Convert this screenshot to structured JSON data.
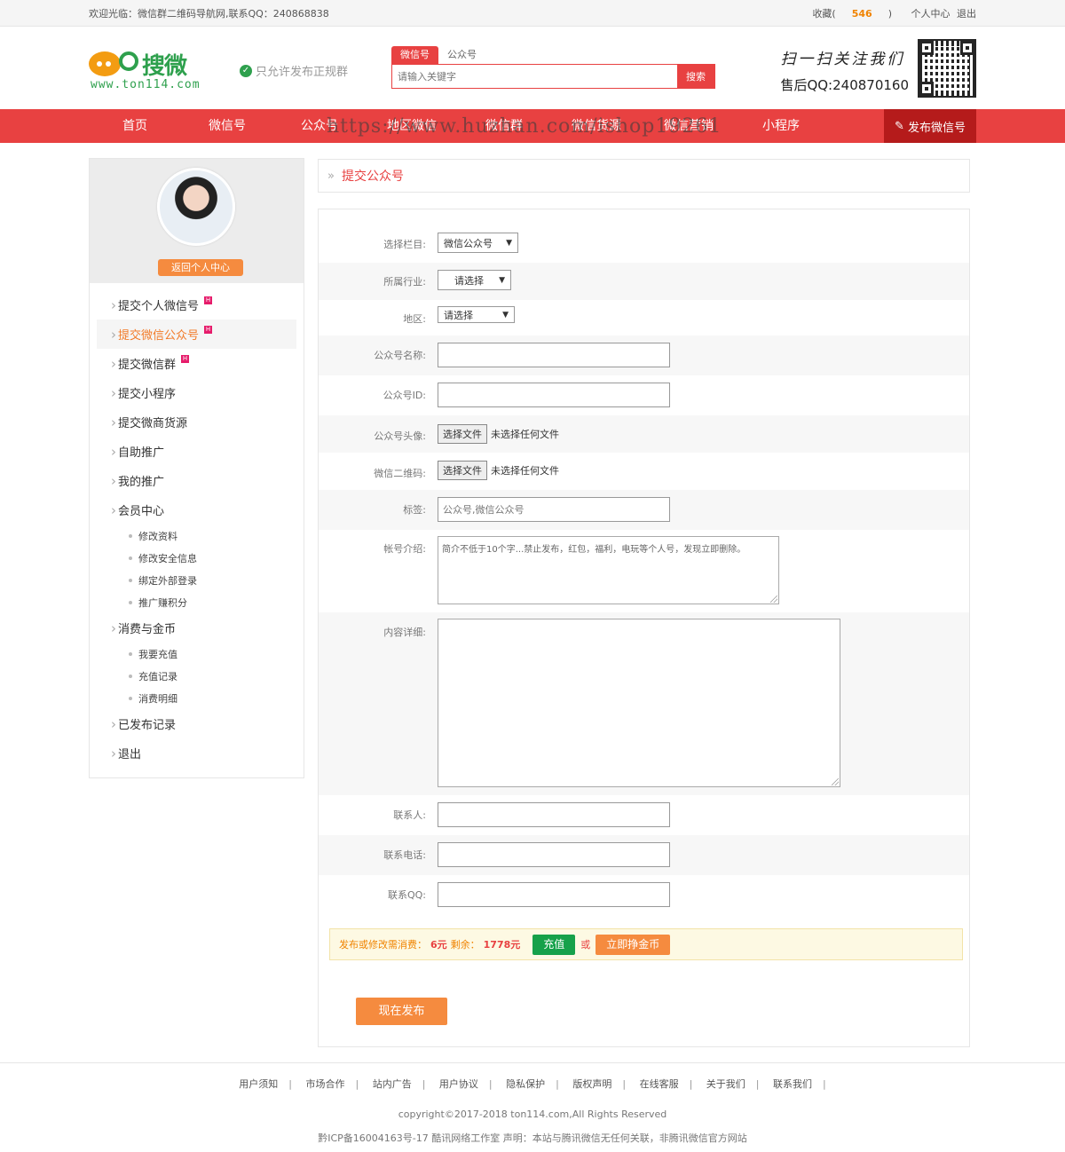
{
  "topbar": {
    "welcome": "欢迎光临：微信群二维码导航网,联系QQ：240868838",
    "fav_label": "收藏(",
    "fav_count": "546",
    "fav_close": ")",
    "user_center": "个人中心",
    "logout": "退出"
  },
  "header": {
    "brand": "搜微",
    "url": "www.ton114.com",
    "verified": "只允许发布正规群",
    "slogan": "扫一扫关注我们",
    "service_qq": "售后QQ:240870160"
  },
  "search": {
    "tabs": [
      "微信号",
      "公众号"
    ],
    "placeholder": "请输入关键字",
    "button": "搜索"
  },
  "nav": {
    "items": [
      "首页",
      "微信号",
      "公众号",
      "地区微信",
      "微信群",
      "微信货源",
      "微信营销",
      "小程序"
    ],
    "publish": "发布微信号"
  },
  "watermark": "https://www.huzhan.com/ishop19261",
  "sidebar": {
    "back": "返回个人中心",
    "menu": [
      {
        "label": "提交个人微信号",
        "hot": true
      },
      {
        "label": "提交微信公众号",
        "hot": true,
        "active": true
      },
      {
        "label": "提交微信群",
        "hot": true
      },
      {
        "label": "提交小程序"
      },
      {
        "label": "提交微商货源"
      },
      {
        "label": "自助推广"
      },
      {
        "label": "我的推广"
      },
      {
        "label": "会员中心"
      }
    ],
    "member_sub": [
      "修改资料",
      "修改安全信息",
      "绑定外部登录",
      "推广赚积分"
    ],
    "consume": "消费与金币",
    "consume_sub": [
      "我要充值",
      "充值记录",
      "消费明细"
    ],
    "published": "已发布记录",
    "exit": "退出"
  },
  "breadcrumb": {
    "arrow": "»",
    "title": "提交公众号"
  },
  "form": {
    "column_label": "选择栏目:",
    "column_value": "微信公众号",
    "industry_label": "所属行业:",
    "industry_value": "请选择",
    "region_label": "地区:",
    "region_value": "请选择",
    "name_label": "公众号名称:",
    "id_label": "公众号ID:",
    "avatar_label": "公众号头像:",
    "qrcode_label": "微信二维码:",
    "file_button": "选择文件",
    "file_none": "未选择任何文件",
    "tags_label": "标签:",
    "tags_value": "公众号,微信公众号",
    "intro_label": "帐号介绍:",
    "intro_value": "简介不低于10个字...禁止发布，红包，福利，电玩等个人号，发现立即删除。",
    "content_label": "内容详细:",
    "contact_label": "联系人:",
    "phone_label": "联系电话:",
    "qq_label": "联系QQ:"
  },
  "payment": {
    "text1": "发布或修改需消费：",
    "cost": "6元",
    "text2": "剩余：",
    "balance": "1778元",
    "recharge": "充值",
    "or": "或",
    "earn": "立即挣金币"
  },
  "submit": "现在发布",
  "footer": {
    "links": [
      "用户须知",
      "市场合作",
      "站内广告",
      "用户协议",
      "隐私保护",
      "版权声明",
      "在线客服",
      "关于我们",
      "联系我们"
    ],
    "copyright": "copyright©2017-2018 ton114.com,All Rights Reserved",
    "icp": "黔ICP备16004163号-17 酷讯网络工作室   声明：本站与腾讯微信无任何关联，非腾讯微信官方网站"
  }
}
